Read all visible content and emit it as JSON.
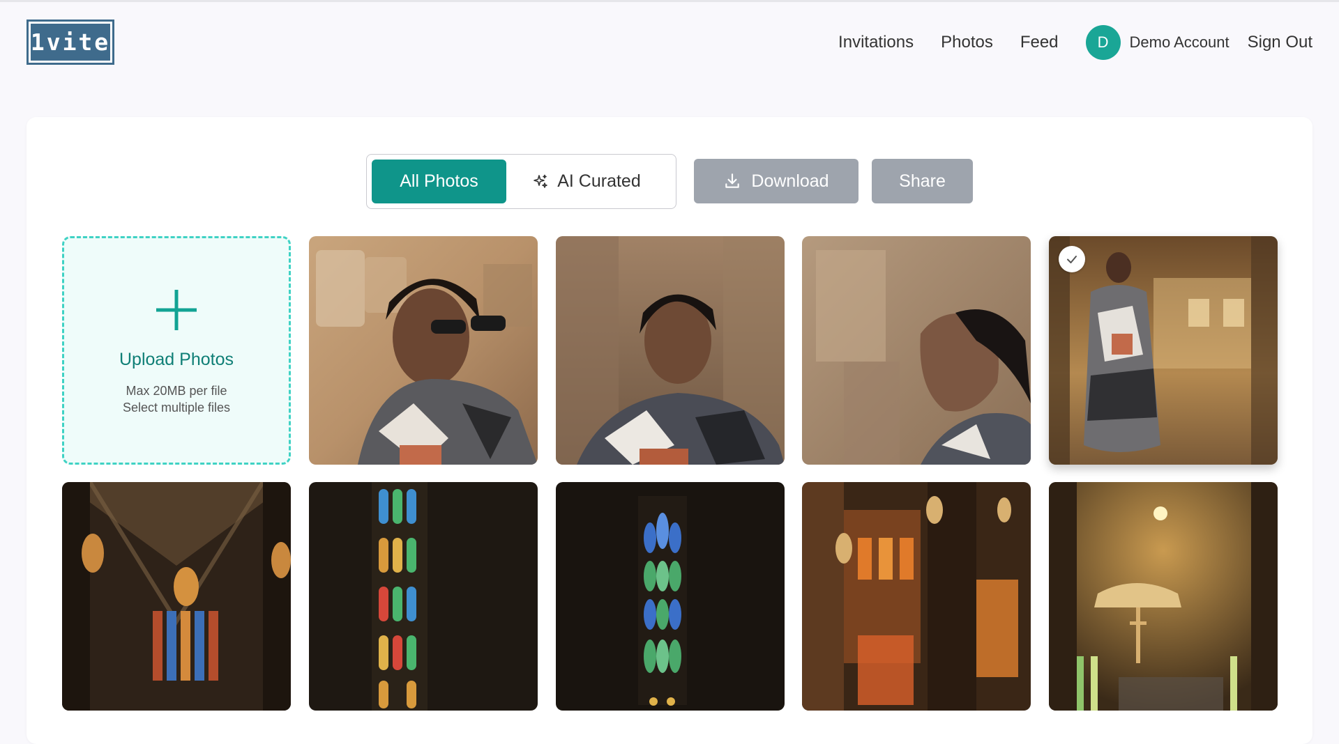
{
  "app": {
    "logo_text": "1vite"
  },
  "nav": {
    "links": [
      "Invitations",
      "Photos",
      "Feed"
    ],
    "account_initial": "D",
    "account_name": "Demo Account",
    "signout": "Sign Out"
  },
  "toolbar": {
    "all_photos_label": "All Photos",
    "ai_curated_label": "AI Curated",
    "download_label": "Download",
    "share_label": "Share"
  },
  "upload": {
    "title": "Upload Photos",
    "line1": "Max 20MB per file",
    "line2": "Select multiple files"
  },
  "photos": [
    {
      "subject": "woman-sunglasses-portrait",
      "selected": false
    },
    {
      "subject": "woman-portrait-stone-background",
      "selected": false
    },
    {
      "subject": "woman-looking-up-profile",
      "selected": false
    },
    {
      "subject": "woman-standing-in-cathedral",
      "selected": true
    },
    {
      "subject": "cathedral-vaulted-ceiling-window",
      "selected": false
    },
    {
      "subject": "stained-glass-window-tall",
      "selected": false
    },
    {
      "subject": "stained-glass-window-blue-green",
      "selected": false
    },
    {
      "subject": "cathedral-columns-orange-glass",
      "selected": false
    },
    {
      "subject": "cathedral-altar-crucifix",
      "selected": false
    }
  ],
  "colors": {
    "accent": "#0f958a",
    "upload_border": "#3fd2c4",
    "upload_bg": "#effcfa",
    "disabled_button": "#9ea4ad",
    "logo": "#3f6b8c",
    "avatar": "#1aa696"
  },
  "icons": {
    "ai_curated": "sparkle-icon",
    "download": "download-icon",
    "upload": "plus-icon",
    "selected": "check-icon"
  }
}
